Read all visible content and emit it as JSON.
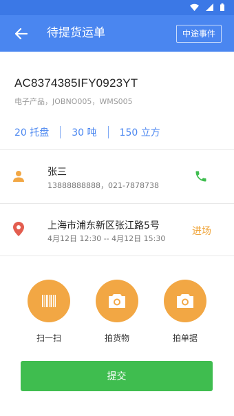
{
  "header": {
    "title": "待提货运单",
    "event_button": "中途事件"
  },
  "order": {
    "number": "AC8374385IFY0923YT",
    "description": "电子产品，JOBNO005，WMS005",
    "stats": {
      "pallets": "20 托盘",
      "tons": "30 吨",
      "cubic": "150 立方"
    }
  },
  "contact": {
    "name": "张三",
    "phones": "13888888888，021-7878738"
  },
  "address": {
    "text": "上海市浦东新区张江路5号",
    "start_date": "4月12日",
    "start_time": "12:30",
    "separator": "--",
    "end_date": "4月12日",
    "end_time": "15:30",
    "enter_label": "进场"
  },
  "actions": {
    "scan": "扫一扫",
    "photo_goods": "拍货物",
    "photo_receipt": "拍单据"
  },
  "submit_label": "提交",
  "colors": {
    "primary": "#4a86f0",
    "status_bar": "#3b78e6",
    "orange": "#f2a744",
    "green": "#3fbd4f",
    "pin_red": "#e35d4f"
  }
}
